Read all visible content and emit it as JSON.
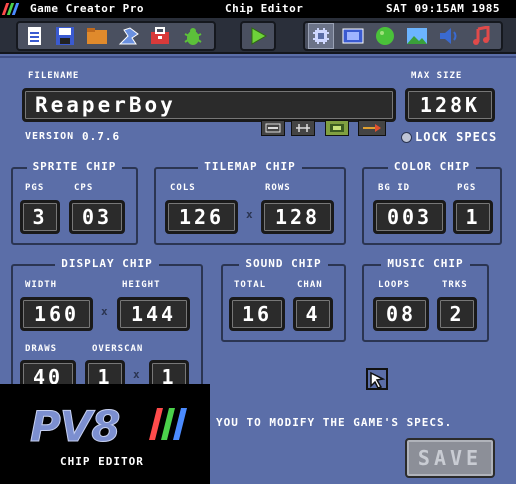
{
  "menubar": {
    "app_title": "Game Creator Pro",
    "editor_title": "Chip Editor",
    "clock": "SAT 09:15AM 1985"
  },
  "toolbar": {
    "icons": [
      "new-file-icon",
      "save-disk-icon",
      "folder-icon",
      "tools-icon",
      "toolbox-icon",
      "bug-icon",
      "play-icon",
      "chip-editor-icon",
      "sprite-editor-icon",
      "color-editor-icon",
      "image-icon",
      "sound-icon",
      "music-icon"
    ]
  },
  "file": {
    "filename_label": "FILENAME",
    "filename_value": "ReaperBoy",
    "max_size_label": "MAX SIZE",
    "max_size_value": "128K",
    "version_label": "VERSION",
    "version_value": "0.7.6",
    "lock_label": "LOCK SPECS"
  },
  "sprite_chip": {
    "title": "SPRITE CHIP",
    "pgs_label": "PGS",
    "pgs": "3",
    "cps_label": "CPS",
    "cps": "03"
  },
  "tilemap_chip": {
    "title": "TILEMAP CHIP",
    "cols_label": "COLS",
    "cols": "126",
    "rows_label": "ROWS",
    "rows": "128"
  },
  "color_chip": {
    "title": "COLOR CHIP",
    "bgid_label": "BG ID",
    "bgid": "003",
    "pgs_label": "PGS",
    "pgs": "1"
  },
  "display_chip": {
    "title": "DISPLAY CHIP",
    "width_label": "WIDTH",
    "width": "160",
    "height_label": "HEIGHT",
    "height": "144",
    "draws_label": "DRAWS",
    "draws": "40",
    "overscan_label": "OVERSCAN",
    "overscan_x": "1",
    "overscan_y": "1"
  },
  "sound_chip": {
    "title": "SOUND CHIP",
    "total_label": "TOTAL",
    "total": "16",
    "chan_label": "CHAN",
    "chan": "4"
  },
  "music_chip": {
    "title": "MUSIC CHIP",
    "loops_label": "LOOPS",
    "loops": "08",
    "trks_label": "TRKS",
    "trks": "2"
  },
  "times_symbol": "x",
  "message": "YOU TO MODIFY THE GAME'S SPECS.",
  "save_label": "SAVE",
  "splash": {
    "logo": "PV8",
    "caption": "CHIP EDITOR"
  },
  "colors": {
    "background": "#5b6ea8",
    "field": "#2b2b2b",
    "menubar": "#000000"
  }
}
